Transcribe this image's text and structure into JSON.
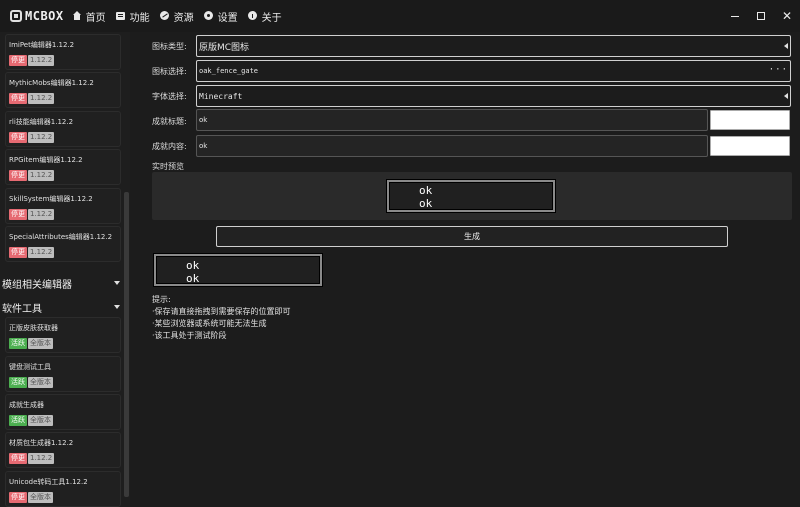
{
  "app": {
    "logo_text": "MCBOX",
    "nav": [
      {
        "label": "首页",
        "icon": "home-icon"
      },
      {
        "label": "功能",
        "icon": "function-icon"
      },
      {
        "label": "资源",
        "icon": "resource-icon"
      },
      {
        "label": "设置",
        "icon": "settings-icon"
      },
      {
        "label": "关于",
        "icon": "info-icon"
      }
    ],
    "window_controls": {
      "close": "✕"
    }
  },
  "sidebar": {
    "cards_top": [
      {
        "title": "ImiPet编辑器1.12.2",
        "status": "停更",
        "version": "1.12.2"
      },
      {
        "title": "MythicMobs编辑器1.12.2",
        "status": "停更",
        "version": "1.12.2"
      },
      {
        "title": "rli技能编辑器1.12.2",
        "status": "停更",
        "version": "1.12.2"
      },
      {
        "title": "RPGitem编辑器1.12.2",
        "status": "停更",
        "version": "1.12.2"
      },
      {
        "title": "SkillSystem编辑器1.12.2",
        "status": "停更",
        "version": "1.12.2"
      },
      {
        "title": "SpecialAttributes编辑器1.12.2",
        "status": "停更",
        "version": "1.12.2"
      }
    ],
    "section_mod": "模组相关编辑器",
    "section_tools": "软件工具",
    "cards_tools": [
      {
        "title": "正版皮肤获取器",
        "status": "活跃",
        "version": "全版本"
      },
      {
        "title": "键盘测试工具",
        "status": "活跃",
        "version": "全版本"
      },
      {
        "title": "成就生成器",
        "status": "活跃",
        "version": "全版本"
      },
      {
        "title": "材质包生成器1.12.2",
        "status": "停更",
        "version": "1.12.2"
      },
      {
        "title": "Unicode转码工具1.12.2",
        "status": "停更",
        "version": "全版本"
      }
    ]
  },
  "form": {
    "icon_type_label": "图标类型:",
    "icon_type_value": "原版MC图标",
    "icon_select_label": "图标选择:",
    "icon_select_value": "oak_fence_gate",
    "icon_select_more": "···",
    "font_label": "字体选择:",
    "font_value": "Minecraft",
    "title_label": "成就标题:",
    "title_value": "ok",
    "content_label": "成就内容:",
    "content_value": "ok",
    "title_color": "#ffffff",
    "content_color": "#ffffff"
  },
  "preview": {
    "label": "实时预览",
    "line1": "ok",
    "line2": "ok"
  },
  "generate_button": "生成",
  "result": {
    "line1": "ok",
    "line2": "ok"
  },
  "tips": [
    "提示:",
    "·保存请直接拖拽到需要保存的位置即可",
    "·某些浏览器或系统可能无法生成",
    "·该工具处于测试阶段"
  ]
}
